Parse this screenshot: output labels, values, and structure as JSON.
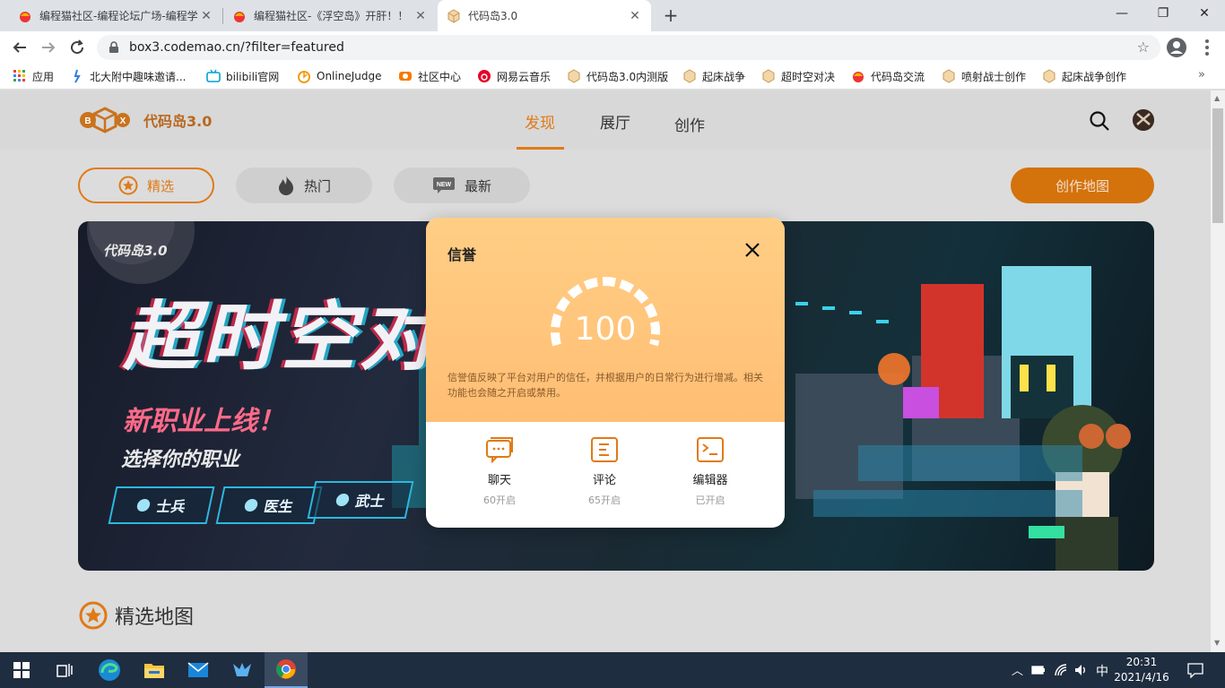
{
  "browser": {
    "tabs": [
      {
        "title": "编程猫社区-编程论坛广场-编程学习",
        "close": "✕"
      },
      {
        "title": "编程猫社区-《浮空岛》开肝！！",
        "close": "✕"
      },
      {
        "title": "代码岛3.0",
        "close": "✕"
      }
    ],
    "new_tab": "+",
    "window_controls": {
      "minimize": "—",
      "maximize": "❐",
      "close": "✕"
    },
    "url": "box3.codemao.cn/?filter=featured",
    "bookmarks": [
      "应用",
      "北大附中趣味邀请...",
      "bilibili官网",
      "OnlineJudge",
      "社区中心",
      "网易云音乐",
      "代码岛3.0内测版",
      "起床战争",
      "超时空对决",
      "代码岛交流",
      "喷射战士创作",
      "起床战争创作"
    ],
    "bookmarks_more": "»"
  },
  "site": {
    "logo_text": "代码岛3.0",
    "nav": [
      "发现",
      "展厅",
      "创作"
    ],
    "filters": [
      "精选",
      "热门",
      "最新"
    ],
    "create_map": "创作地图",
    "section_title": "精选地图"
  },
  "banner": {
    "logo": "代码岛3.0",
    "title": "超时空对决",
    "subtitle": "新职业上线！",
    "prompt": "选择你的职业",
    "jobs": [
      "士兵",
      "医生",
      "武士"
    ]
  },
  "modal": {
    "title": "信誉",
    "score": "100",
    "description": "信誉值反映了平台对用户的信任，并根据用户的日常行为进行增减。相关功能也会随之开启或禁用。",
    "permissions": [
      {
        "label": "聊天",
        "status": "60开启"
      },
      {
        "label": "评论",
        "status": "65开启"
      },
      {
        "label": "编辑器",
        "status": "已开启"
      }
    ]
  },
  "taskbar": {
    "ime": "中",
    "time": "20:31",
    "date": "2021/4/16"
  },
  "colors": {
    "accent": "#e07a16",
    "modal_top": "#ffc47a",
    "taskbar": "#1f2d40"
  }
}
